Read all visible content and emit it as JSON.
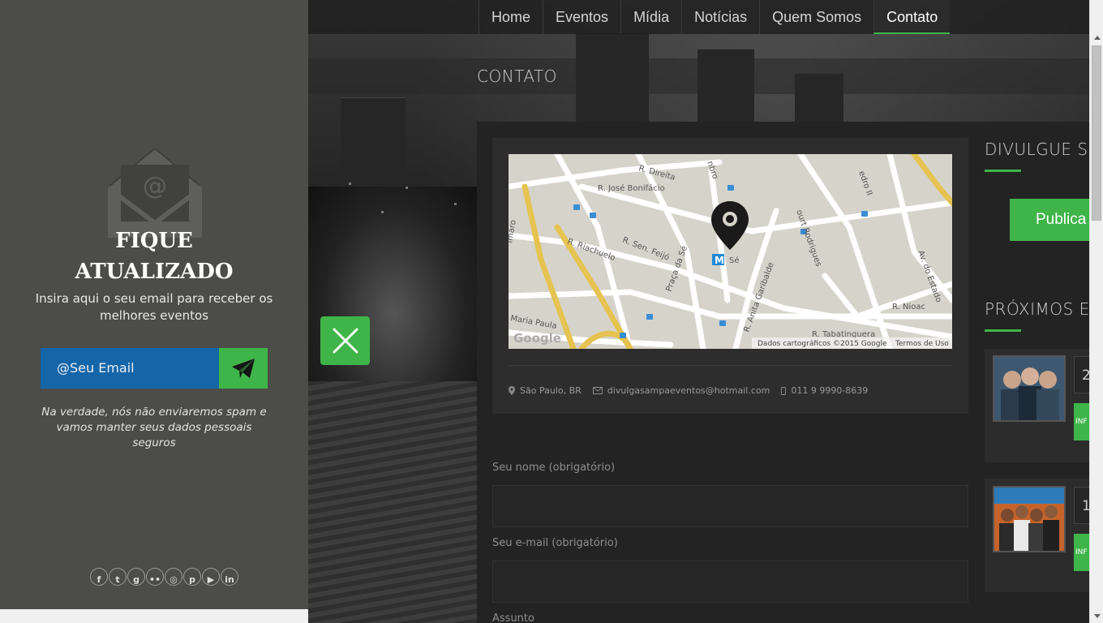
{
  "nav": {
    "items": [
      "Home",
      "Eventos",
      "Mídia",
      "Notícias",
      "Quem Somos",
      "Contato"
    ],
    "active": "Contato"
  },
  "page": {
    "title": "CONTATO"
  },
  "newsletter": {
    "title_line1": "FIQUE",
    "title_line2": "ATUALIZADO",
    "subtitle": "Insira aqui o seu email para receber os melhores eventos",
    "email_placeholder": "@Seu Email",
    "note": "Na verdade, nós não enviaremos spam e vamos manter seus dados pessoais seguros",
    "socials": [
      "facebook-icon",
      "twitter-icon",
      "google-plus-icon",
      "flickr-icon",
      "instagram-icon",
      "pinterest-icon",
      "youtube-icon",
      "linkedin-icon"
    ]
  },
  "map": {
    "streets": [
      "R. Direita",
      "R. José Bonifácio",
      "R. Riachuelo",
      "R. Sen. Feijó",
      "Praça da Sé",
      "R. Anita Garibalde",
      "Av. do Estado",
      "R. Nioac",
      "R. Tabatinguera",
      "Maria Paula",
      "Sé"
    ],
    "attribution": "Dados cartográficos ©2015 Google",
    "terms": "Termos de Uso",
    "logo": "Google"
  },
  "contact": {
    "location": "São Paulo, BR",
    "email": "divulgasampaeventos@hotmail.com",
    "phone": "011 9 9990-8639"
  },
  "form": {
    "name_label": "Seu nome (obrigatório)",
    "email_label": "Seu e-mail (obrigatório)",
    "subject_label": "Assunto"
  },
  "sidebar": {
    "divulgue_title": "DIVULGUE SE",
    "publica_label": "Publica",
    "proximos_title": "PRÓXIMOS E",
    "events": [
      {
        "day": "2",
        "info": "INF"
      },
      {
        "day": "1",
        "info": "INF"
      }
    ]
  },
  "colors": {
    "accent": "#3fb549",
    "email_bg": "#1566a8",
    "panel": "#4c4c48"
  }
}
